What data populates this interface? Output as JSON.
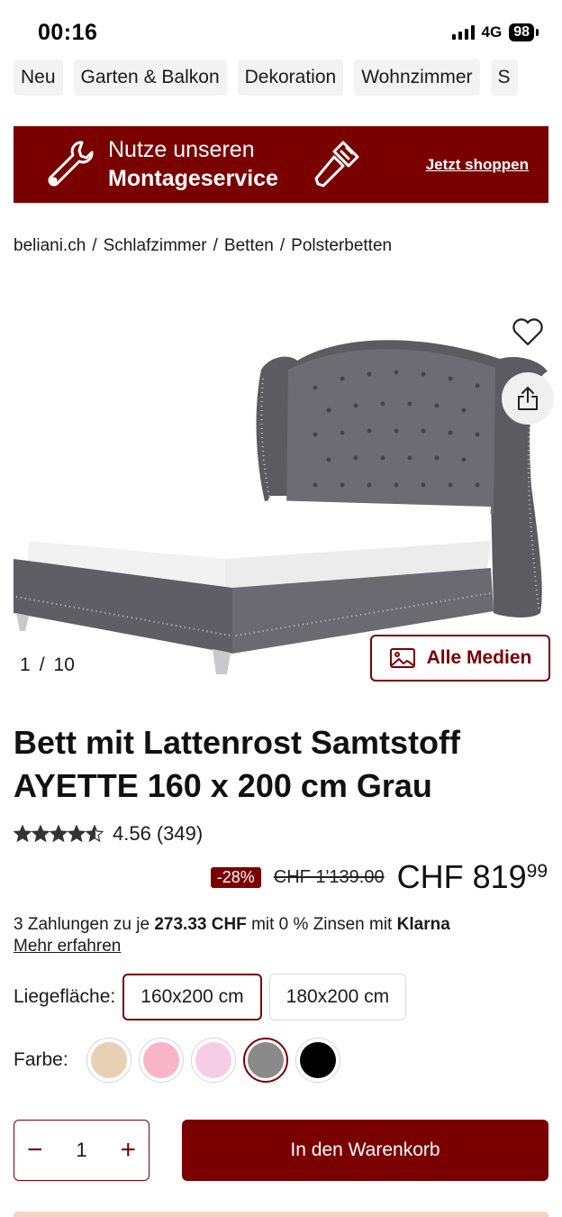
{
  "status_bar": {
    "time": "00:16",
    "network": "4G",
    "battery": "98"
  },
  "categories": [
    "Neu",
    "Garten & Balkon",
    "Dekoration",
    "Wohnzimmer",
    "S"
  ],
  "banner": {
    "line1": "Nutze unseren",
    "line2": "Montageservice",
    "link": "Jetzt shoppen",
    "bg_color": "#7a0000"
  },
  "breadcrumb": [
    "beliani.ch",
    "/",
    "Schlafzimmer",
    "/",
    "Betten",
    "/",
    "Polsterbetten"
  ],
  "gallery": {
    "current": "1",
    "separator": "/",
    "total": "10",
    "media_button": "Alle Medien"
  },
  "product": {
    "title": "Bett mit Lattenrost Samtstoff AYETTE 160 x 200 cm Grau",
    "rating_value": "4.56",
    "rating_count": "(349)",
    "rating_stars": 4.56,
    "discount": "-28%",
    "old_price": "CHF 1'139.00",
    "price_main": "CHF 819",
    "price_cents": "99"
  },
  "klarna": {
    "prefix": "3 Zahlungen zu je",
    "amount": "273.33 CHF",
    "middle": "mit 0 % Zinsen mit",
    "brand": "Klarna",
    "more": "Mehr erfahren"
  },
  "size": {
    "label": "Liegefläche:",
    "options": [
      "160x200 cm",
      "180x200 cm"
    ],
    "selected": "160x200 cm"
  },
  "color": {
    "label": "Farbe:",
    "swatches": [
      "#e8d0b4",
      "#f9b4c7",
      "#f5cde6",
      "#8a8a8a",
      "#000000"
    ],
    "selected_index": 3
  },
  "cart": {
    "quantity": "1",
    "minus": "−",
    "plus": "+",
    "button": "In den Warenkorb"
  },
  "accent_color": "#7a0000"
}
